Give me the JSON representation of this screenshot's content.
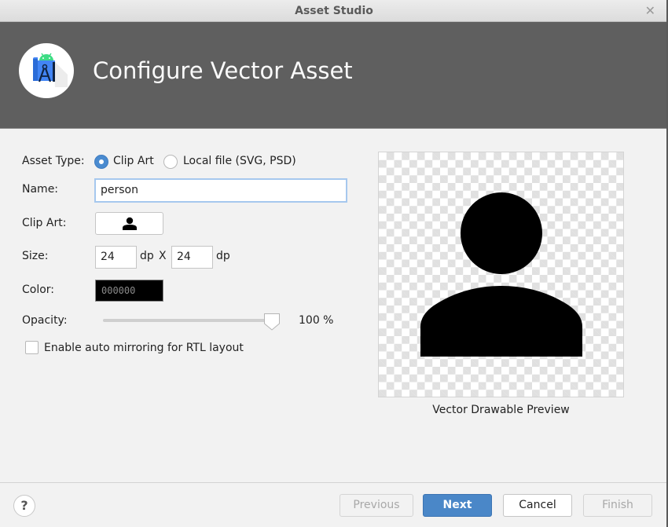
{
  "window": {
    "title": "Asset Studio",
    "close_icon": "close-icon"
  },
  "header": {
    "title": "Configure Vector Asset",
    "logo_icon": "android-studio-logo-icon"
  },
  "form": {
    "asset_type": {
      "label": "Asset Type:",
      "options": [
        {
          "label": "Clip Art",
          "selected": true
        },
        {
          "label": "Local file (SVG, PSD)",
          "selected": false
        }
      ]
    },
    "name": {
      "label": "Name:",
      "value": "person"
    },
    "clip_art": {
      "label": "Clip Art:",
      "icon": "person-icon"
    },
    "size": {
      "label": "Size:",
      "width": "24",
      "height": "24",
      "unit": "dp",
      "separator": "X"
    },
    "color": {
      "label": "Color:",
      "value": "000000"
    },
    "opacity": {
      "label": "Opacity:",
      "value_percent": 100,
      "display": "100 %"
    },
    "auto_mirror": {
      "label": "Enable auto mirroring for RTL layout",
      "checked": false
    }
  },
  "preview": {
    "caption": "Vector Drawable Preview",
    "icon": "person-icon",
    "fill_color": "#000000"
  },
  "footer": {
    "help_icon": "help-icon",
    "help_label": "?",
    "buttons": {
      "previous": {
        "label": "Previous",
        "enabled": false
      },
      "next": {
        "label": "Next",
        "enabled": true,
        "primary": true
      },
      "cancel": {
        "label": "Cancel",
        "enabled": true
      },
      "finish": {
        "label": "Finish",
        "enabled": false
      }
    }
  },
  "colors": {
    "accent": "#4a87c8",
    "header_bg": "#5f5f5f"
  }
}
